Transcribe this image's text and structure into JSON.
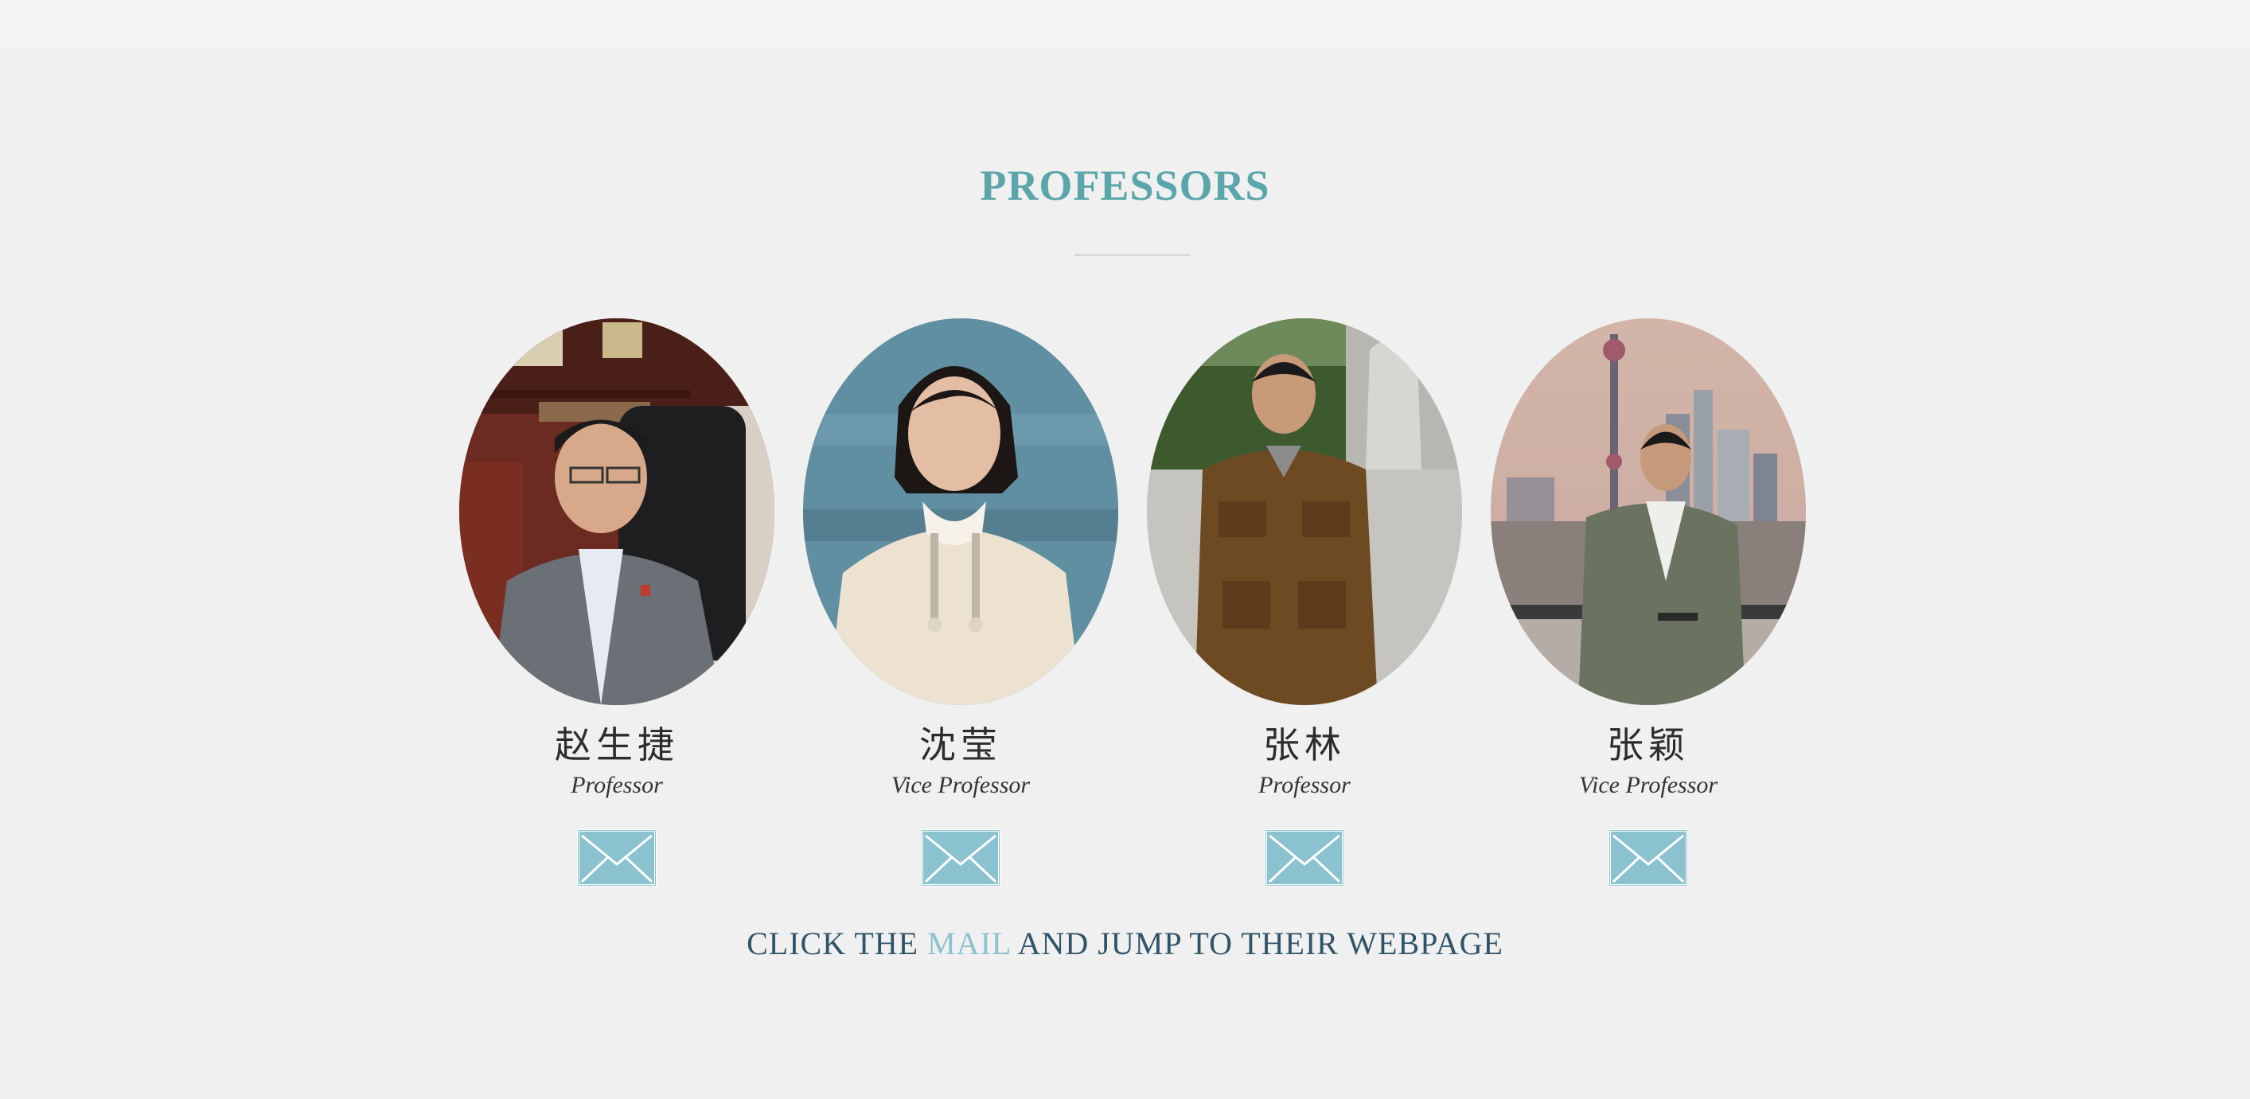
{
  "header": {
    "title": "PROFESSORS"
  },
  "professors": [
    {
      "name": "赵生捷",
      "role": "Professor"
    },
    {
      "name": "沈莹",
      "role": "Vice Professor"
    },
    {
      "name": "张林",
      "role": "Professor"
    },
    {
      "name": "张颖",
      "role": "Vice Professor"
    }
  ],
  "footer": {
    "prefix": "CLICK THE ",
    "highlight": "MAIL",
    "suffix": " AND JUMP TO THEIR WEBPAGE"
  },
  "colors": {
    "accent": "#5aa6aa",
    "mail_icon": "#8ac2cf",
    "footer_text": "#2f546a",
    "background": "#f0f0f0"
  },
  "icons": {
    "mail": "mail-icon"
  }
}
